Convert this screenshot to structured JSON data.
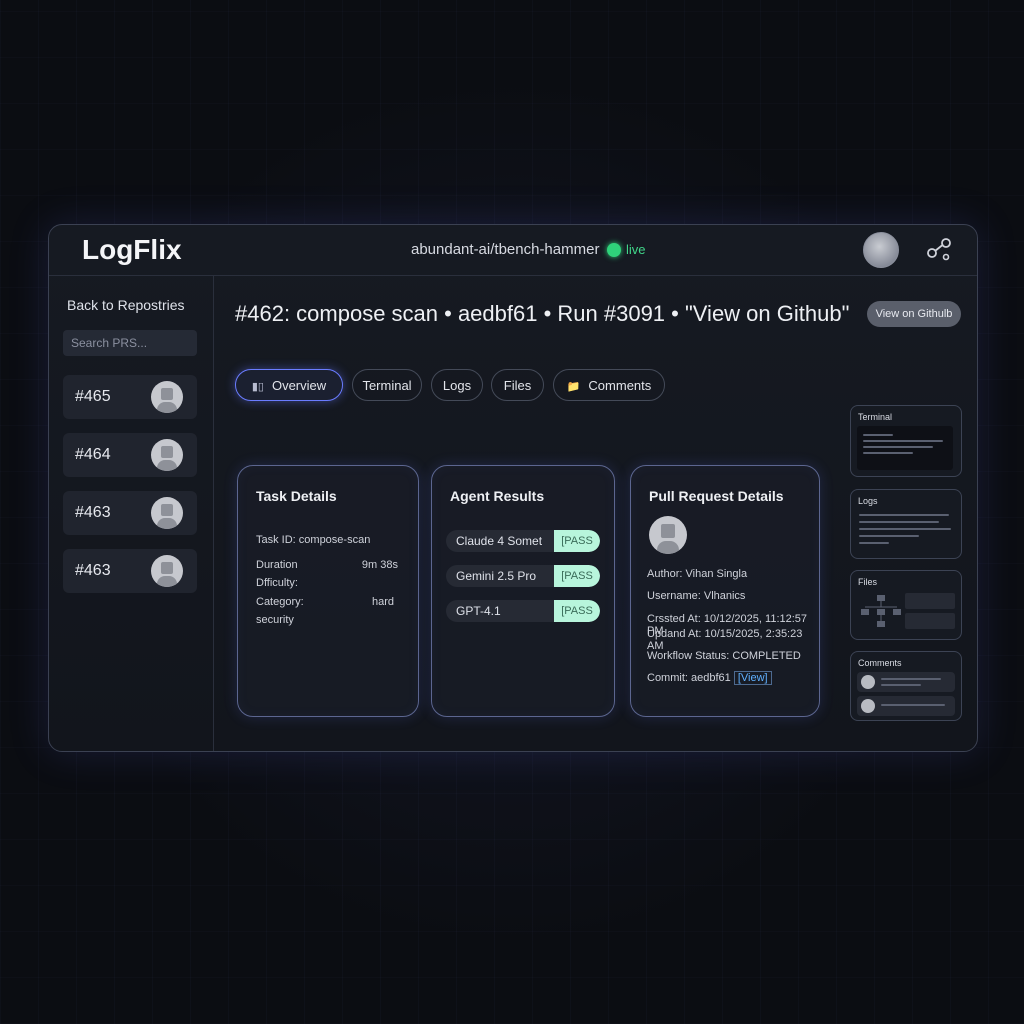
{
  "app": {
    "logo": "LogFlix",
    "repo": "abundant-ai/tbench-hammer",
    "live_label": "live"
  },
  "sidebar": {
    "back_label": "Back to Repostries",
    "search_placeholder": "Search PRS...",
    "items": [
      {
        "label": "#465"
      },
      {
        "label": "#464"
      },
      {
        "label": "#463"
      },
      {
        "label": "#463"
      }
    ]
  },
  "header": {
    "title": "#462: compose scan • aedbf61 • Run #3091 • \"View on Github\"",
    "github_button": "View on Githulb"
  },
  "tabs": [
    {
      "label": "Overview",
      "icon": "chart-icon"
    },
    {
      "label": "Terminal"
    },
    {
      "label": "Logs"
    },
    {
      "label": "Files"
    },
    {
      "label": "Comments",
      "icon": "folder-icon"
    }
  ],
  "task_details": {
    "title": "Task Details",
    "task_id": "Task ID: compose-scan",
    "duration_label": "Duration",
    "duration_value": "9m 38s",
    "difficulty_label": "Dfficulty:",
    "category_label": "Category:",
    "category_value": "hard",
    "category_extra": "security"
  },
  "agent_results": {
    "title": "Agent Results",
    "agents": [
      {
        "name": "Claude 4 Somet",
        "status": "[PASS"
      },
      {
        "name": "Gemini 2.5 Pro",
        "status": "[PASS"
      },
      {
        "name": "GPT-4.1",
        "status": "[PASS"
      }
    ]
  },
  "pr_details": {
    "title": "Pull Request Details",
    "author": "Author: Vihan Singla",
    "username": "Username: Vlhanics",
    "created": "Crssted At: 10/12/2025, 11:12:57 PM",
    "updated": "Updand At: 10/15/2025, 2:35:23 AM",
    "workflow": "Workflow Status: COMPLETED",
    "commit_prefix": "Commit: aedbf61",
    "commit_link": "[View]"
  },
  "mini_panels": {
    "terminal": "Terminal",
    "logs": "Logs",
    "files": "Files",
    "comments": "Comments"
  },
  "colors": {
    "accent": "#6a7cff",
    "live": "#2fd27a",
    "pass_bg": "#b8f5dc"
  }
}
